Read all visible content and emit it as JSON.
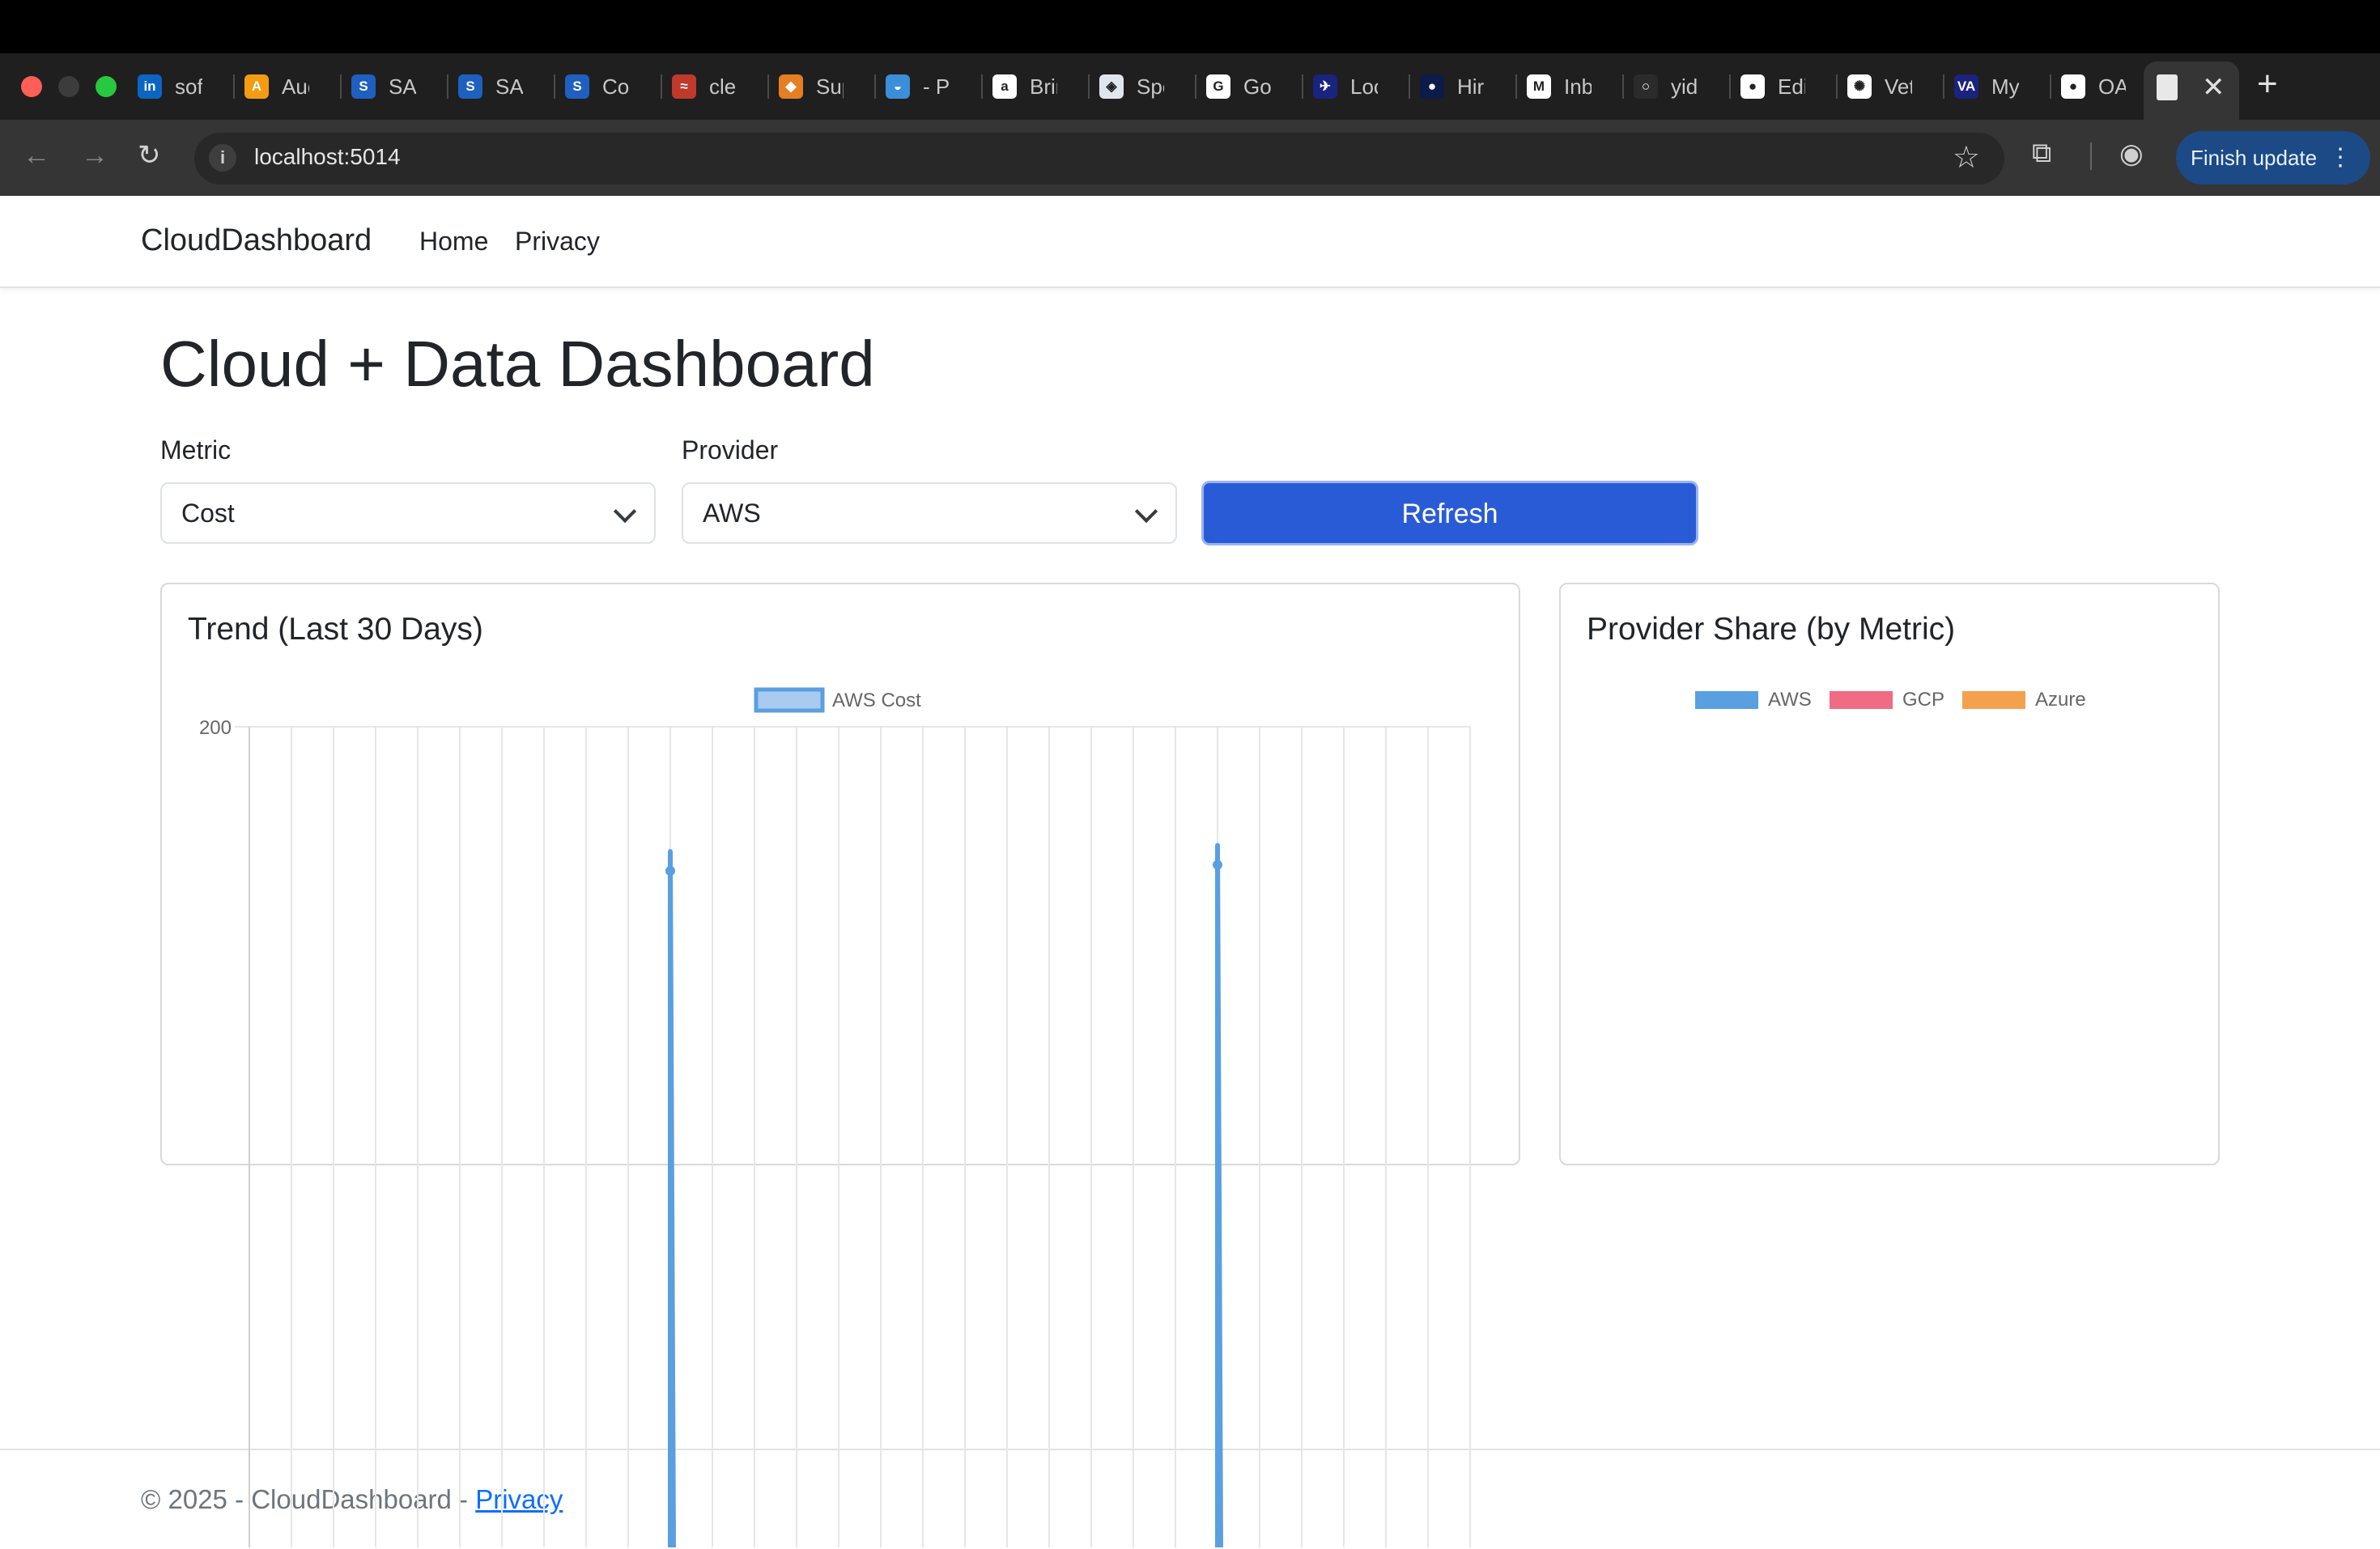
{
  "browser": {
    "tabs": [
      {
        "title": "sof",
        "icon": "linkedin-icon",
        "color": "#0a66c2",
        "glyph": "in"
      },
      {
        "title": "Auc",
        "icon": "audible-icon",
        "color": "#f39c12",
        "glyph": "A"
      },
      {
        "title": "SAI",
        "icon": "saic-icon",
        "color": "#1f5fbf",
        "glyph": "S"
      },
      {
        "title": "SAI",
        "icon": "saic-icon",
        "color": "#1f5fbf",
        "glyph": "S"
      },
      {
        "title": "Cor",
        "icon": "saic-icon",
        "color": "#1f5fbf",
        "glyph": "S"
      },
      {
        "title": "clea",
        "icon": "flag-icon",
        "color": "#c0392b",
        "glyph": "≈"
      },
      {
        "title": "Sup",
        "icon": "box-icon",
        "color": "#e67e22",
        "glyph": "◆"
      },
      {
        "title": "- Pa",
        "icon": "cap-icon",
        "color": "#3b8ed8",
        "glyph": "◒"
      },
      {
        "title": "Brir",
        "icon": "amazon-icon",
        "color": "#ffffff",
        "glyph": "a"
      },
      {
        "title": "Spe",
        "icon": "shield-icon",
        "color": "#dfe6f0",
        "glyph": "◈"
      },
      {
        "title": "Goo",
        "icon": "google-icon",
        "color": "#ffffff",
        "glyph": "G"
      },
      {
        "title": "Loc",
        "icon": "plane-icon",
        "color": "#1a237e",
        "glyph": "✈"
      },
      {
        "title": "Hir",
        "icon": "hire-icon",
        "color": "#0d1b4a",
        "glyph": "●"
      },
      {
        "title": "Inb",
        "icon": "gmail-icon",
        "color": "#ffffff",
        "glyph": "M"
      },
      {
        "title": "yid",
        "icon": "circle-icon",
        "color": "#2b2b2b",
        "glyph": "○"
      },
      {
        "title": "Edi",
        "icon": "github-icon",
        "color": "#ffffff",
        "glyph": "●"
      },
      {
        "title": "Vet",
        "icon": "openai-icon",
        "color": "#ffffff",
        "glyph": "✺"
      },
      {
        "title": "My",
        "icon": "va-icon",
        "color": "#1a237e",
        "glyph": "VA"
      },
      {
        "title": "OAu",
        "icon": "github-icon",
        "color": "#ffffff",
        "glyph": "●"
      }
    ],
    "new_tab": "+",
    "close_tab": "✕",
    "url": "localhost:5014",
    "finish_update": "Finish update"
  },
  "nav": {
    "brand": "CloudDashboard",
    "links": [
      "Home",
      "Privacy"
    ]
  },
  "page": {
    "title": "Cloud + Data Dashboard",
    "metric_label": "Metric",
    "metric_value": "Cost",
    "provider_label": "Provider",
    "provider_value": "AWS",
    "refresh_label": "Refresh"
  },
  "trend_card": {
    "title": "Trend (Last 30 Days)"
  },
  "share_card": {
    "title": "Provider Share (by Metric)"
  },
  "footer": {
    "text": "© 2025 - CloudDashboard - ",
    "link": "Privacy"
  },
  "colors": {
    "aws": "#5a9fe0",
    "gcp": "#f06b84",
    "azure": "#f4a14e",
    "primary": "#2a5bd7"
  },
  "chart_data": [
    {
      "type": "line",
      "series": [
        {
          "name": "AWS Cost",
          "points": [
            [
              10,
              118
            ],
            [
              23,
              122
            ]
          ]
        }
      ],
      "y_tick_labels": [
        "200"
      ],
      "ylim": [
        0,
        200
      ],
      "legend": "top-center",
      "grid": true
    },
    {
      "type": "pie",
      "categories": [
        "AWS",
        "GCP",
        "Azure"
      ],
      "values": [],
      "legend": "top-center"
    }
  ]
}
